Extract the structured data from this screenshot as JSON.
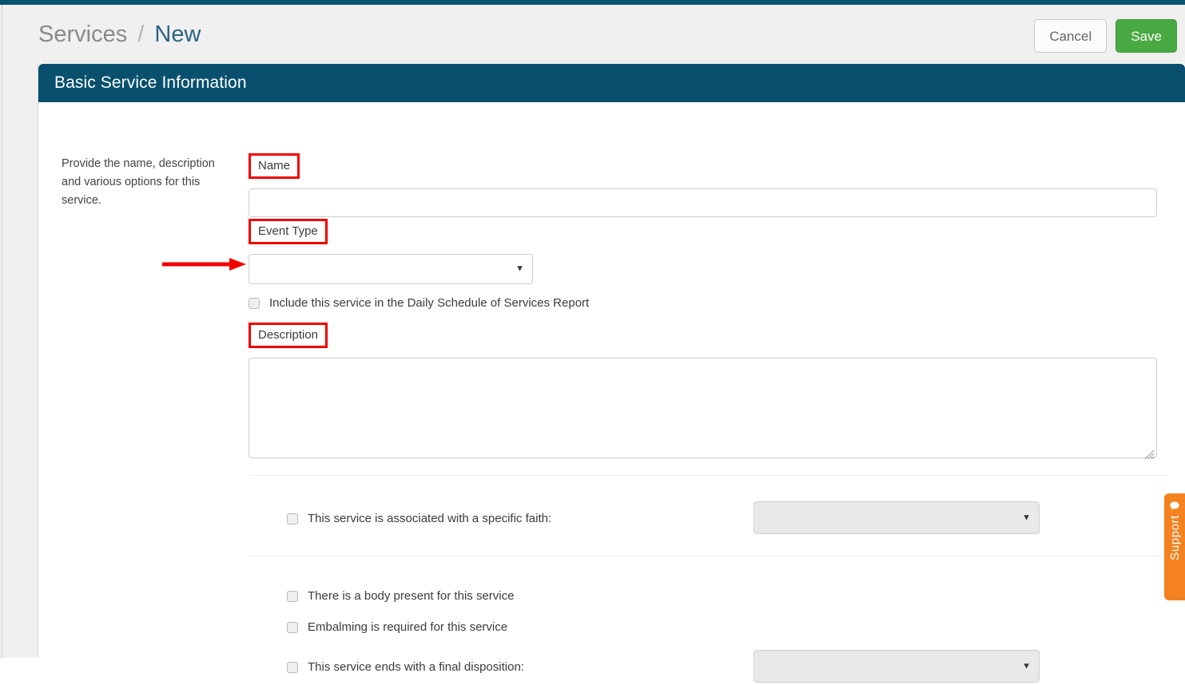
{
  "topbar": {
    "accent_color": "#0b5270"
  },
  "header": {
    "breadcrumb": {
      "parent": "Services",
      "separator": "/",
      "current": "New"
    },
    "cancel_label": "Cancel",
    "save_label": "Save",
    "save_color": "#49a942"
  },
  "panel": {
    "title": "Basic Service Information",
    "header_color": "#08506e"
  },
  "help": {
    "text": "Provide the name, description and various options for this service."
  },
  "fields": {
    "name": {
      "label": "Name",
      "value": "",
      "placeholder": ""
    },
    "event_type": {
      "label": "Event Type",
      "value": "",
      "caret": "▼"
    },
    "daily_schedule": {
      "label": "Include this service in the Daily Schedule of Services Report",
      "checked": false
    },
    "description": {
      "label": "Description",
      "value": "",
      "placeholder": ""
    },
    "faith": {
      "label": "This service is associated with a specific faith:",
      "checked": false,
      "select_value": "",
      "select_disabled": true,
      "caret": "▼"
    },
    "body_present": {
      "label": "There is a body present for this service",
      "checked": false
    },
    "embalming": {
      "label": "Embalming is required for this service",
      "checked": false
    },
    "final_disposition": {
      "label": "This service ends with a final disposition:",
      "checked": false,
      "select_value": "",
      "select_disabled": true,
      "caret": "▼"
    }
  },
  "annotations": {
    "color": "#f20000",
    "arrow_target": "daily-schedule-checkbox",
    "boxed_labels": [
      "Name",
      "Event Type",
      "Description"
    ]
  },
  "support": {
    "label": "Support",
    "color": "#f58220",
    "icon": "chat-bubble-icon"
  }
}
